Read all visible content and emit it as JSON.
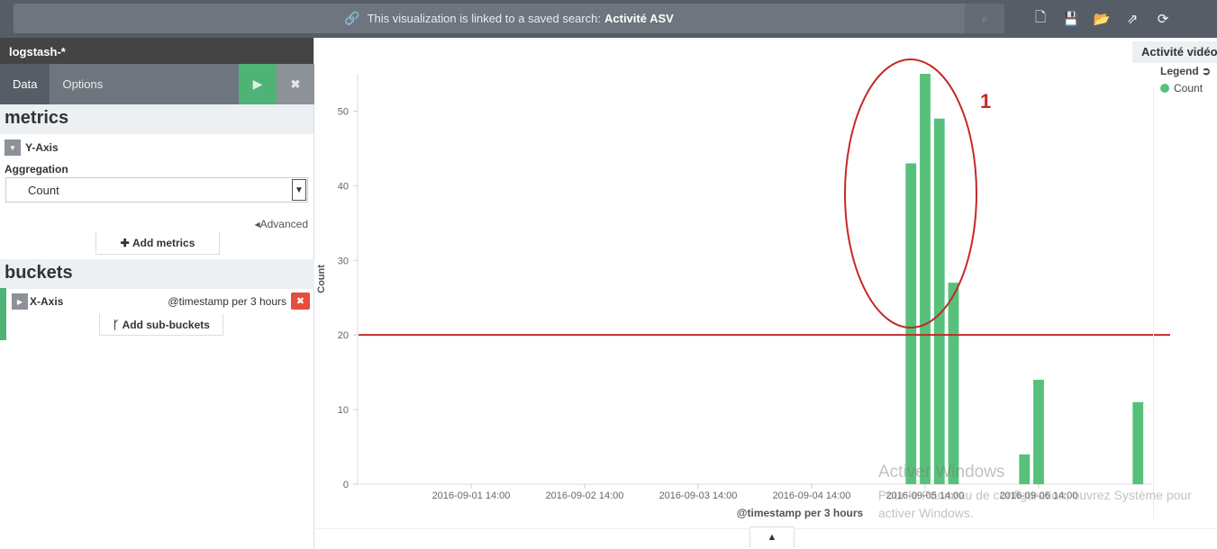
{
  "topbar": {
    "linked_text": "This visualization is linked to a saved search:",
    "saved_search": "Activité ASV",
    "icons": [
      "new-visualization-icon",
      "save-icon",
      "open-icon",
      "share-icon",
      "refresh-icon"
    ]
  },
  "sidebar": {
    "index": "logstash-*",
    "tabs": [
      {
        "label": "Data"
      },
      {
        "label": "Options"
      }
    ],
    "metrics_title": "metrics",
    "yaxis_label": "Y-Axis",
    "aggregation_label": "Aggregation",
    "aggregation_value": "Count",
    "advanced_label": "Advanced",
    "add_metrics_label": "Add metrics",
    "buckets_title": "buckets",
    "xaxis_label": "X-Axis",
    "xaxis_desc": "@timestamp per 3 hours",
    "add_sub_buckets_label": "Add sub-buckets"
  },
  "visualization": {
    "title": "Activité vidéo",
    "legend_label": "Legend",
    "legend_items": [
      {
        "label": "Count",
        "color": "#57c17b"
      }
    ],
    "annotation_number": "1"
  },
  "watermark": {
    "line1": "Activer Windows",
    "line2": "Pour le Panneau de configuration, ouvrez Système pour activer Windows."
  },
  "chart_data": {
    "type": "bar",
    "ylabel": "Count",
    "xlabel": "@timestamp per 3 hours",
    "ylim": [
      0,
      55
    ],
    "yticks": [
      0,
      10,
      20,
      30,
      40,
      50
    ],
    "x_tick_labels": [
      "2016-09-01 14:00",
      "2016-09-02 14:00",
      "2016-09-03 14:00",
      "2016-09-04 14:00",
      "2016-09-05 14:00",
      "2016-09-06 14:00"
    ],
    "x_start": "2016-08-31 14:00",
    "x_end": "2016-09-07 14:00",
    "bar_color": "#57c17b",
    "series": [
      {
        "name": "Count",
        "points": [
          {
            "x": "2016-09-05 11:00",
            "y": 43
          },
          {
            "x": "2016-09-05 14:00",
            "y": 55
          },
          {
            "x": "2016-09-05 17:00",
            "y": 49
          },
          {
            "x": "2016-09-05 20:00",
            "y": 27
          },
          {
            "x": "2016-09-06 11:00",
            "y": 4
          },
          {
            "x": "2016-09-06 14:00",
            "y": 14
          },
          {
            "x": "2016-09-07 11:00",
            "y": 11
          }
        ]
      }
    ],
    "threshold_line": {
      "y": 20,
      "color": "#c62828"
    },
    "highlight_color": "#c62828"
  }
}
